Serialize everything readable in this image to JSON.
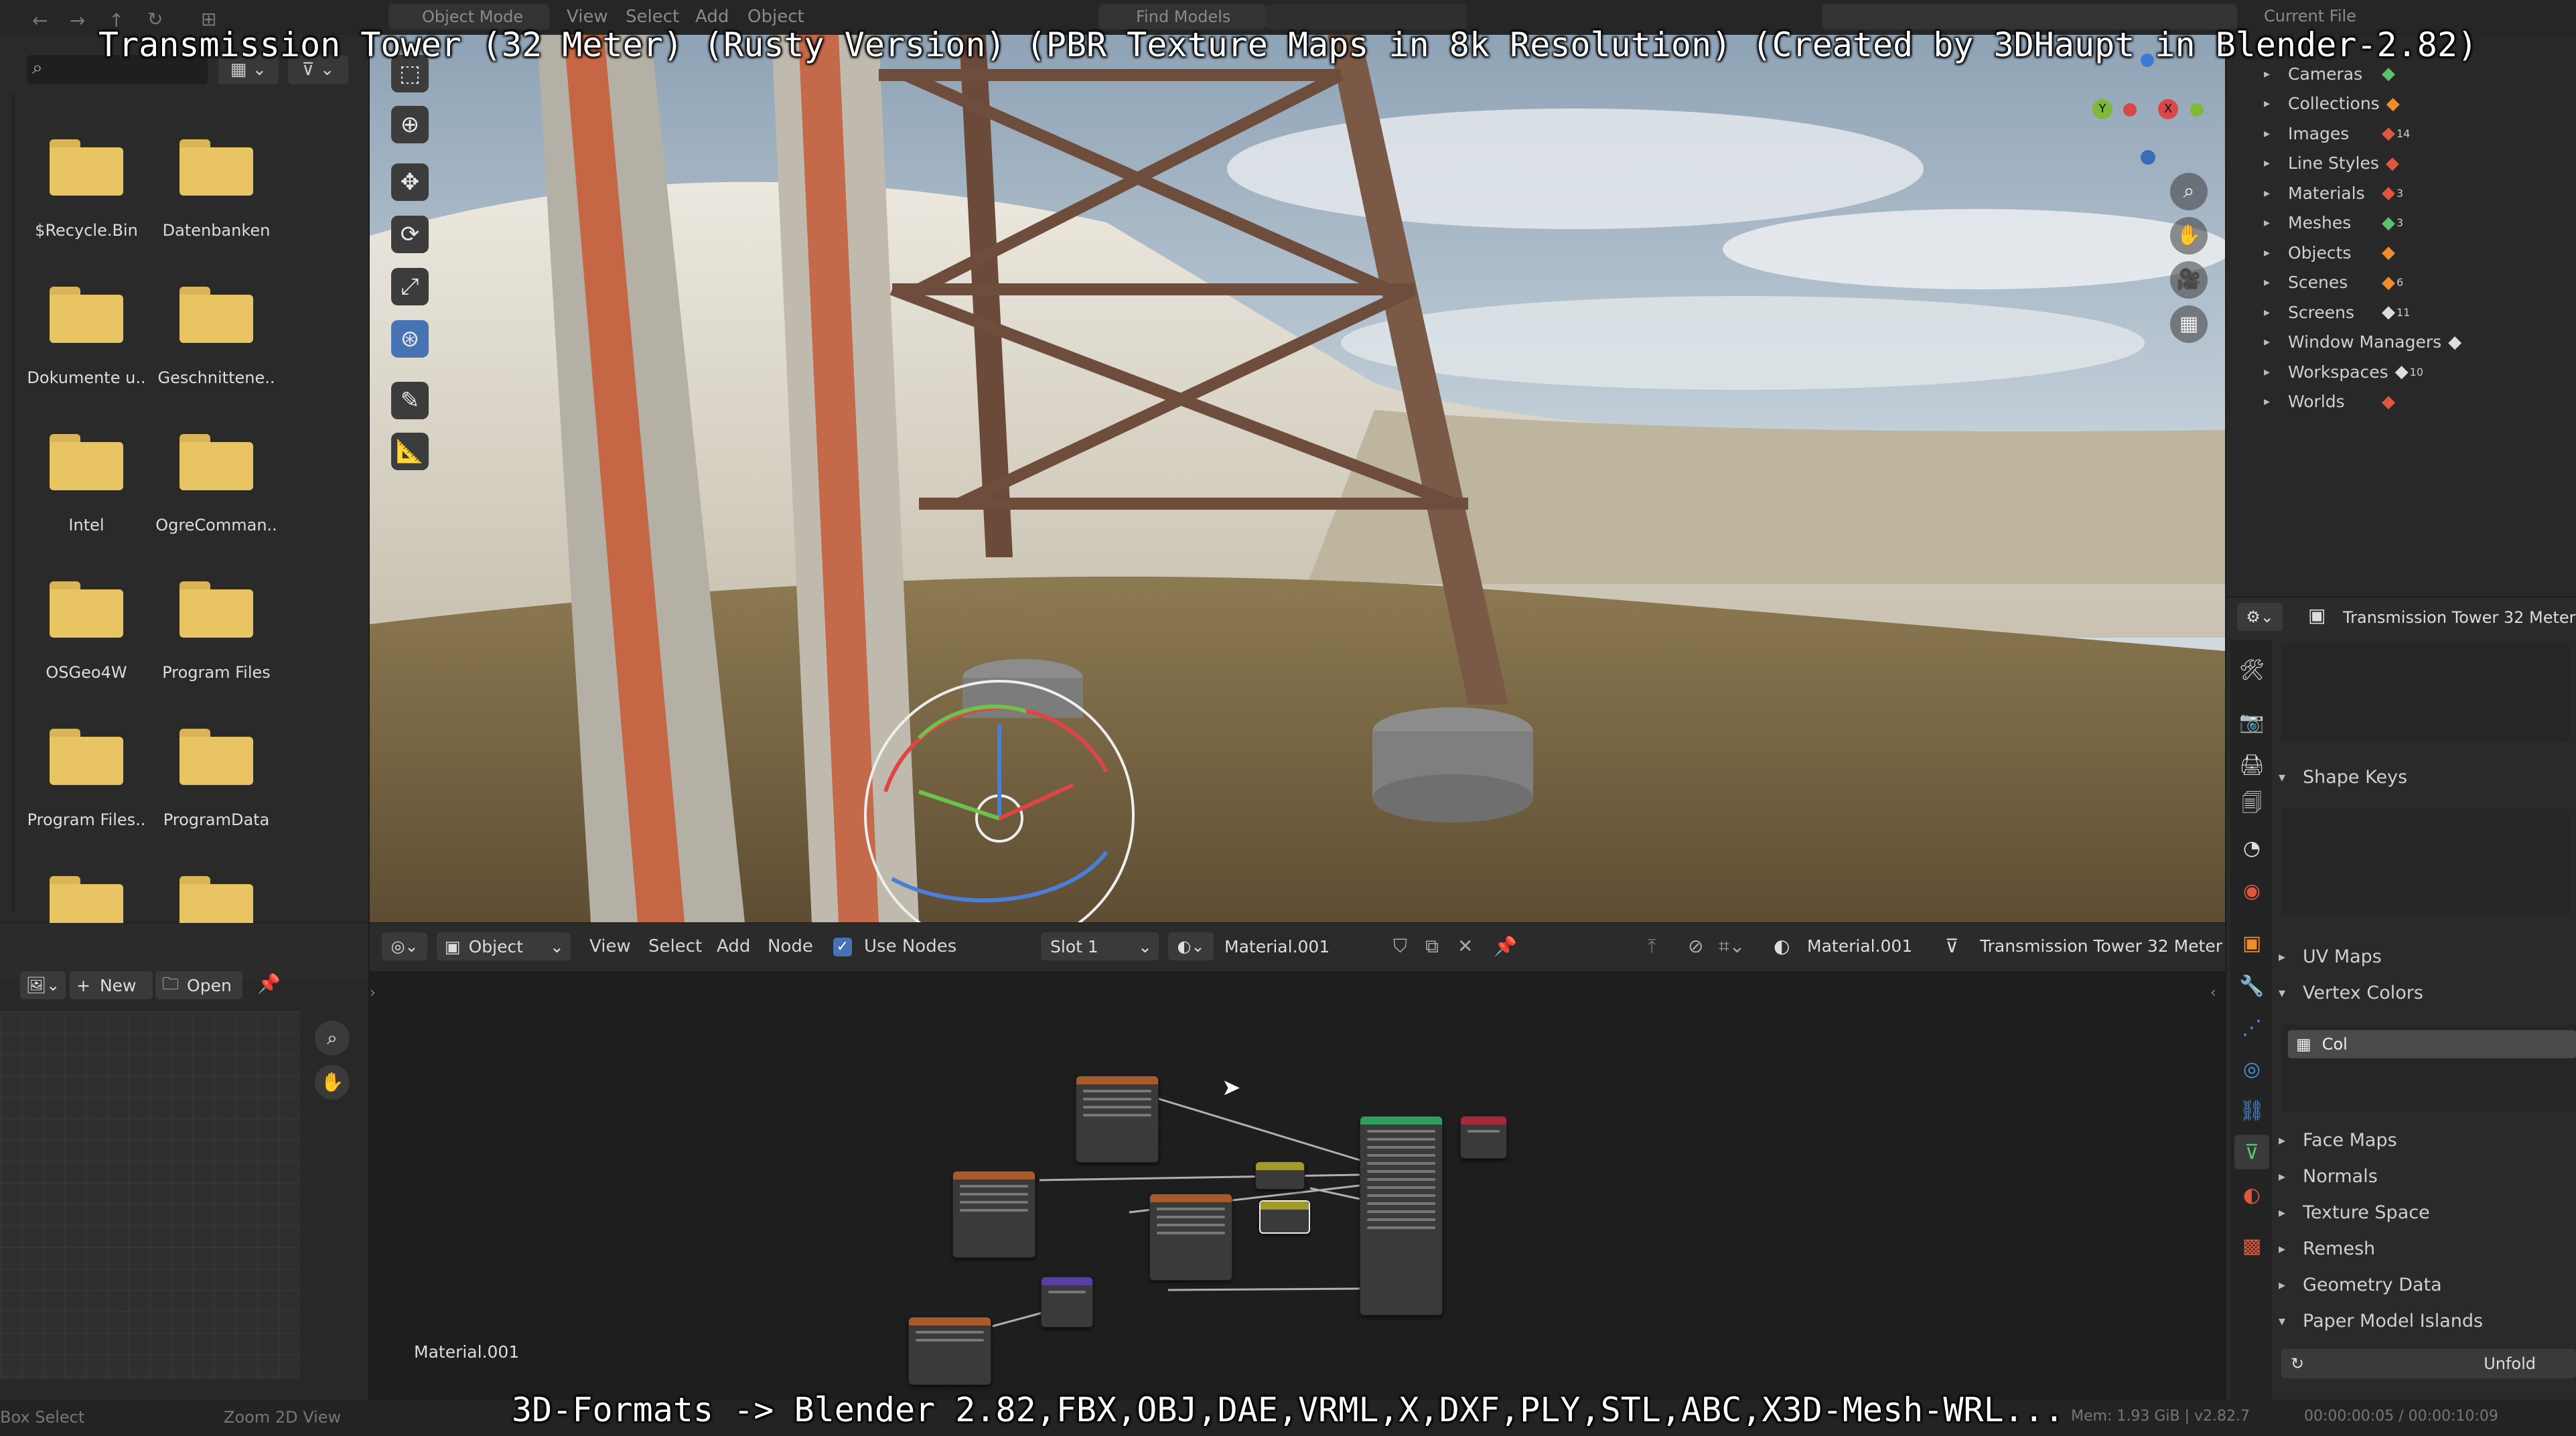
{
  "overlay": {
    "title": "Transmission Tower (32 Meter) (Rusty Version) (PBR Texture Maps in 8k Resolution) (Created by 3DHaupt in Blender-2.82)",
    "caption": "3D-Formats -> Blender 2.82,FBX,OBJ,DAE,VRML,X,DXF,PLY,STL,ABC,X3D-Mesh-WRL..."
  },
  "top_header": {
    "mode": "Object Mode",
    "menus": [
      "View",
      "Select",
      "Add",
      "Object"
    ],
    "search_placeholder": "Find Models",
    "outliner_display": "Current File"
  },
  "file_browser": {
    "folders": [
      "$Recycle.Bin",
      "Datenbanken",
      "Dokumente u..",
      "Geschnittene..",
      "Intel",
      "OgreComman..",
      "OSGeo4W",
      "Program Files",
      "Program Files..",
      "ProgramData",
      "",
      ""
    ]
  },
  "image_editor": {
    "new_label": "New",
    "open_label": "Open"
  },
  "node_editor": {
    "type": "Object",
    "menus": [
      "View",
      "Select",
      "Add",
      "Node"
    ],
    "use_nodes_label": "Use Nodes",
    "slot": "Slot 1",
    "material": "Material.001",
    "material_right": "Material.001",
    "object_name": "Transmission Tower 32 Meter",
    "footer_material": "Material.001"
  },
  "outliner": {
    "items": [
      {
        "label": "Cameras"
      },
      {
        "label": "Collections"
      },
      {
        "label": "Images",
        "count": "14"
      },
      {
        "label": "Line Styles"
      },
      {
        "label": "Materials",
        "count": "3"
      },
      {
        "label": "Meshes",
        "count": "3"
      },
      {
        "label": "Objects"
      },
      {
        "label": "Scenes",
        "count": "6"
      },
      {
        "label": "Screens",
        "count": "11"
      },
      {
        "label": "Window Managers"
      },
      {
        "label": "Workspaces",
        "count": "10"
      },
      {
        "label": "Worlds"
      }
    ]
  },
  "properties": {
    "object_name": "Transmission Tower 32 Meter",
    "sections": [
      {
        "label": "Shape Keys",
        "open": true
      },
      {
        "label": "UV Maps",
        "open": false
      },
      {
        "label": "Vertex Colors",
        "open": true
      },
      {
        "label": "Face Maps",
        "open": false
      },
      {
        "label": "Normals",
        "open": false
      },
      {
        "label": "Texture Space",
        "open": false
      },
      {
        "label": "Remesh",
        "open": false
      },
      {
        "label": "Geometry Data",
        "open": false
      },
      {
        "label": "Paper Model Islands",
        "open": true
      }
    ],
    "vertex_color_item": "Col",
    "unfold_label": "Unfold"
  },
  "status_bar": {
    "left_1": "Box Select",
    "left_2": "Zoom 2D View",
    "memory": "Mem: 1.93 GiB | v2.82.7",
    "time": "00:00:00:05 / 00:00:10:09"
  },
  "colors": {
    "accent": "#4772b3",
    "folder": "#e8c463",
    "viewport_sky": "#b9c7d2",
    "rust": "#c85a33"
  }
}
